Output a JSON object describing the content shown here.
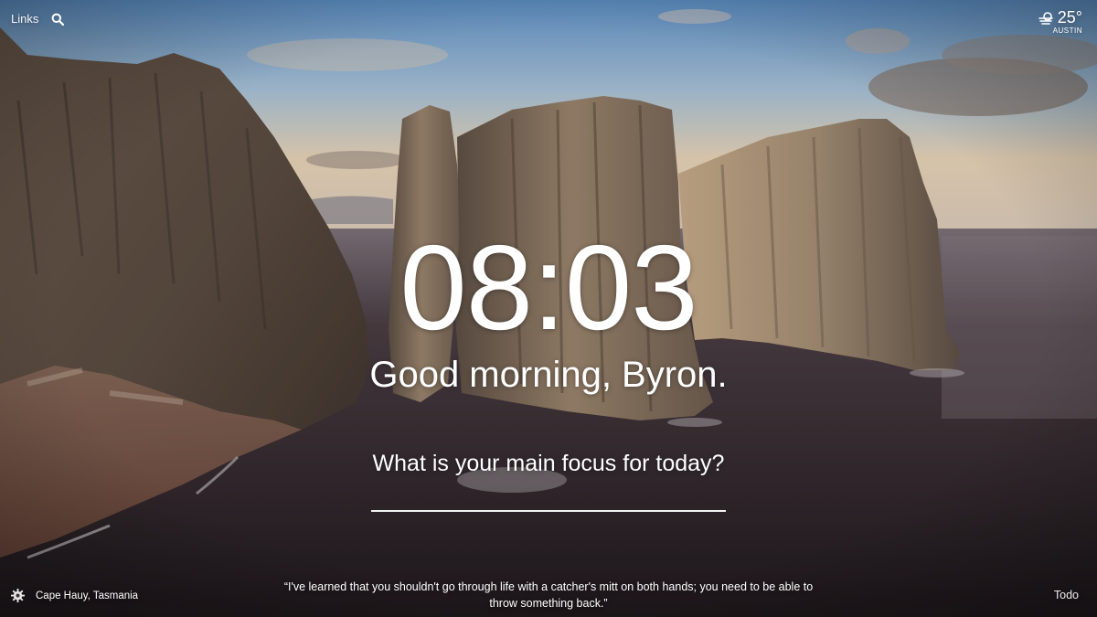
{
  "top_bar": {
    "links_label": "Links",
    "search_icon": "search-icon"
  },
  "weather": {
    "icon": "partly-cloudy-icon",
    "temperature": "25°",
    "location": "AUSTIN"
  },
  "main": {
    "time": "08:03",
    "greeting": "Good morning, Byron.",
    "focus_question": "What is your main focus for today?",
    "focus_input_value": ""
  },
  "bottom_bar": {
    "settings_icon": "gear-icon",
    "photo_location": "Cape Hauy, Tasmania",
    "quote": "“I've learned that you shouldn't go through life with a catcher's mitt on both hands; you need to be able to throw something back.”",
    "todo_label": "Todo"
  },
  "colors": {
    "text": "#ffffff",
    "sky_top": "#6f9ccc",
    "sky_bottom": "#e9d2b4",
    "sea": "#2b2227",
    "rock_light": "#a08a74",
    "rock_dark": "#4f4238"
  }
}
